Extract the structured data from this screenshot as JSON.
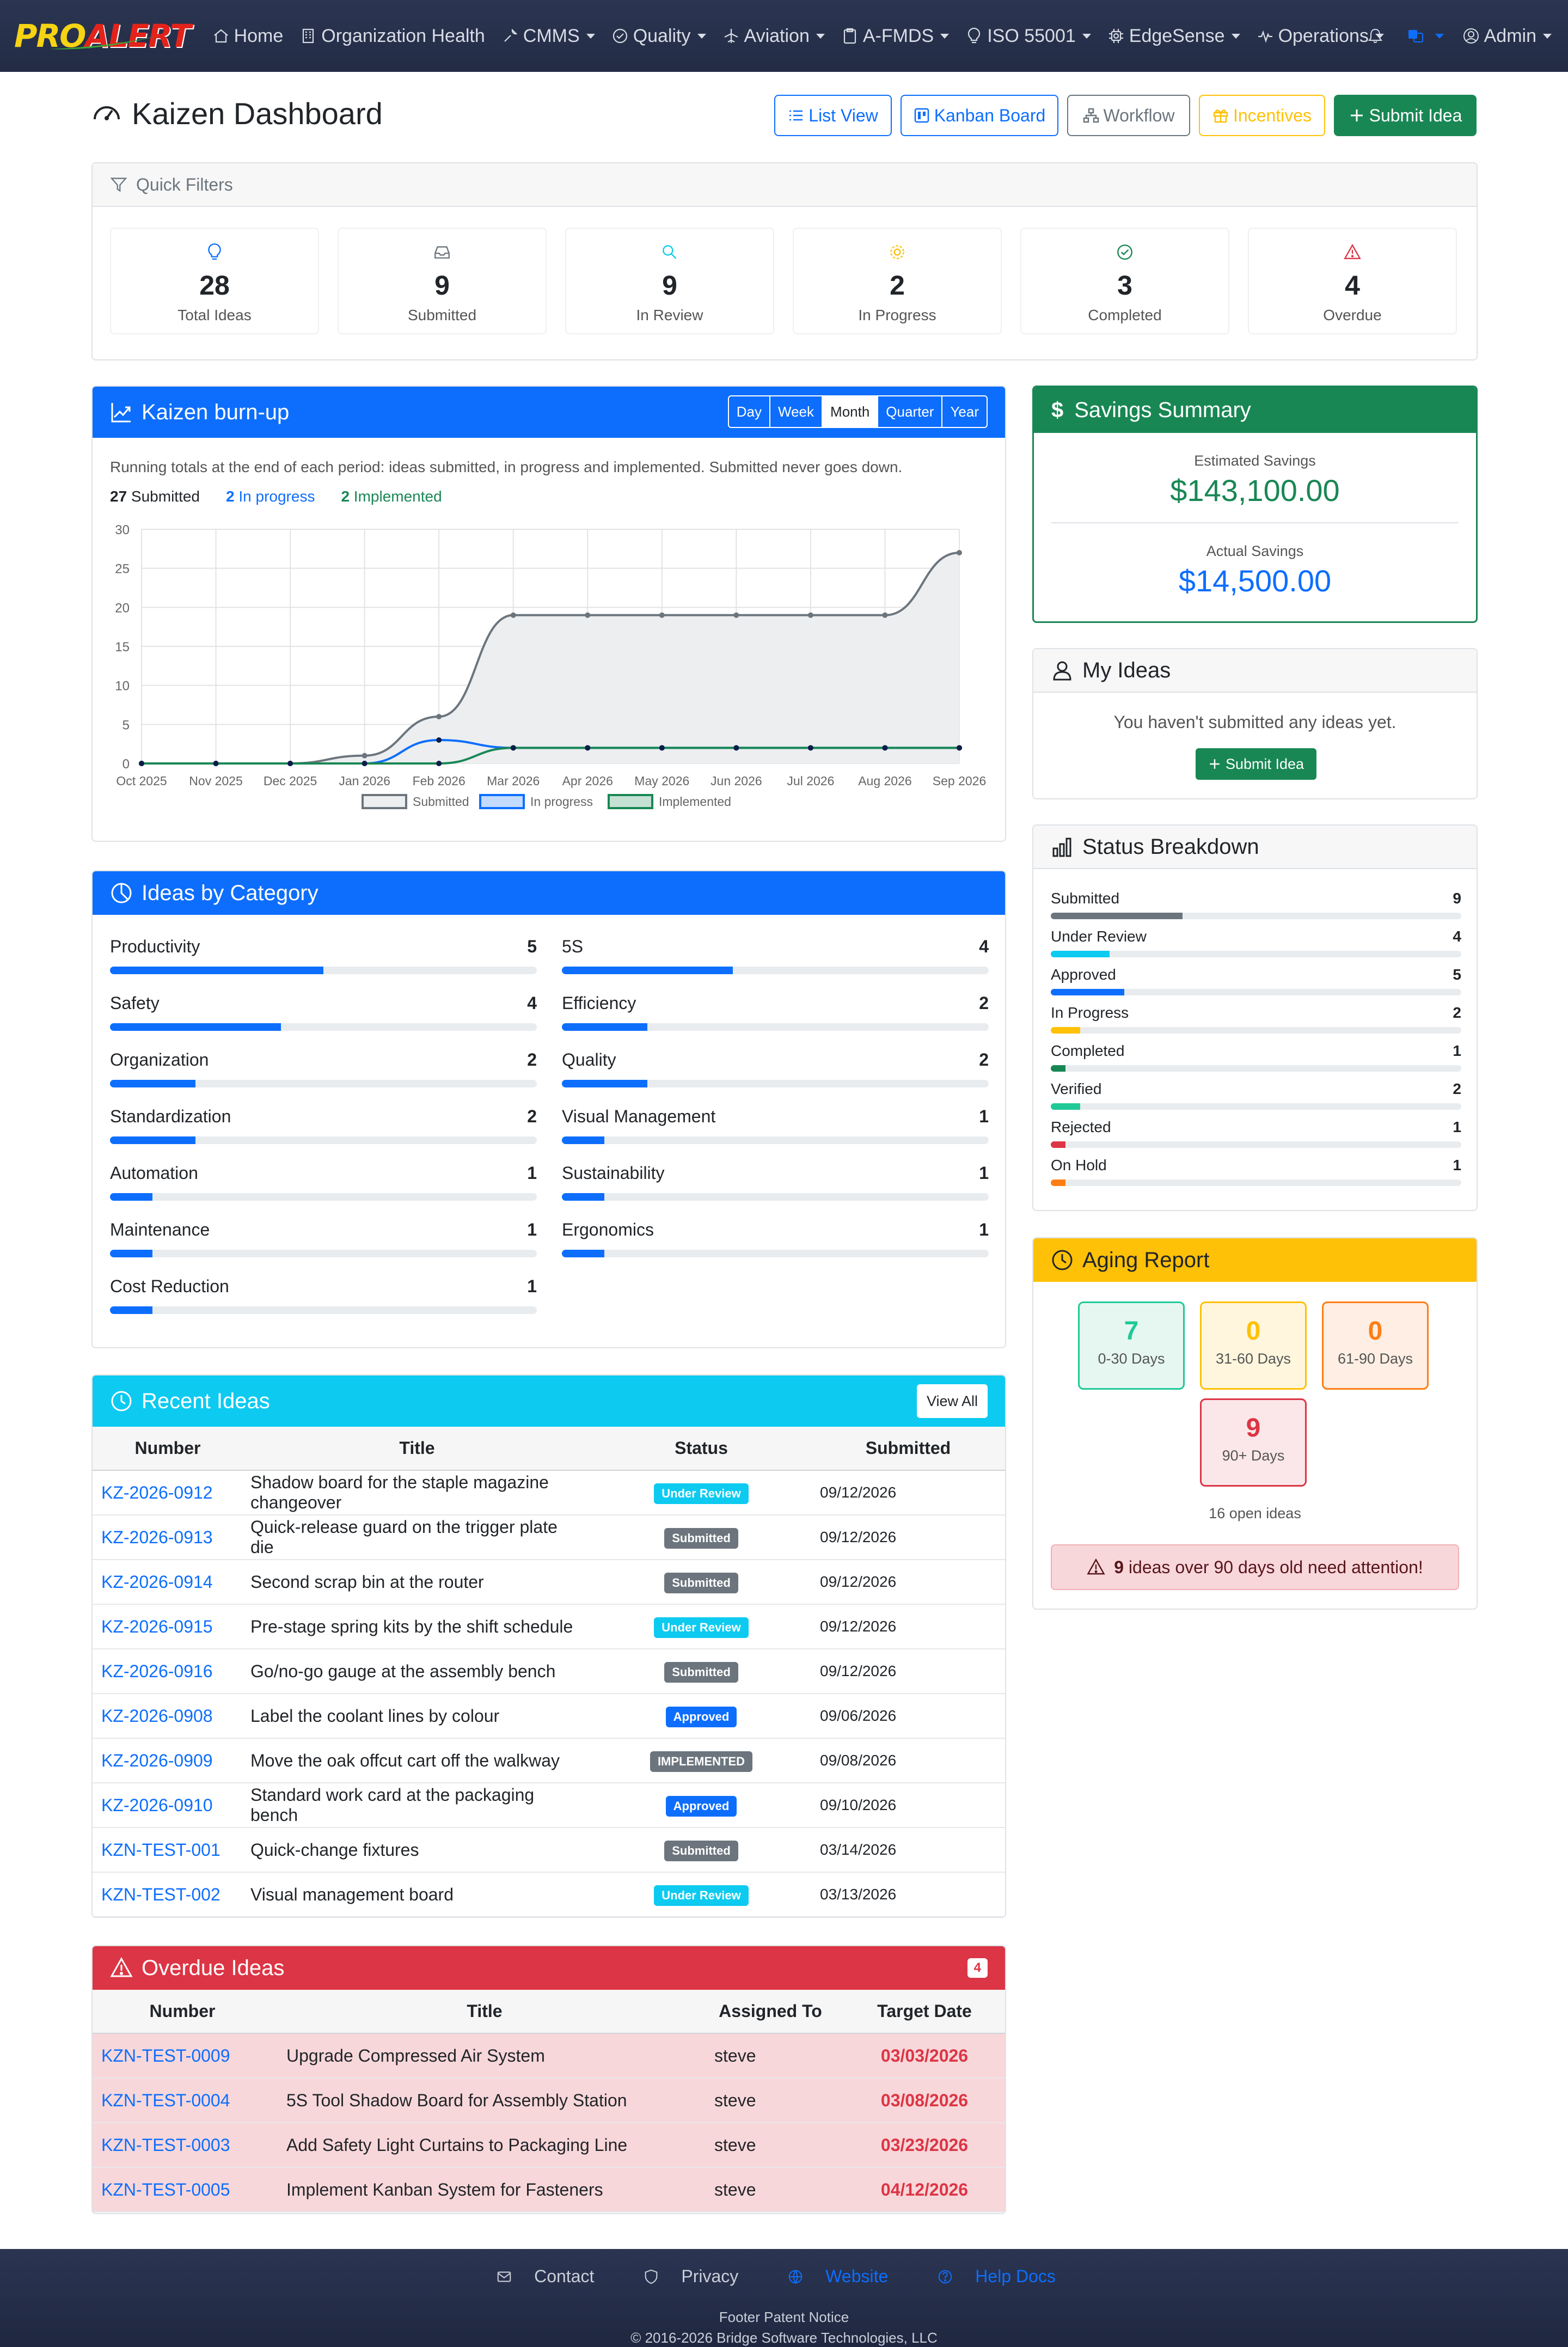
{
  "app": {
    "logo_pro": "PRO",
    "logo_alert": "ALERT",
    "nav": [
      {
        "label": "Home",
        "icon": "home-icon"
      },
      {
        "label": "Organization Health",
        "icon": "building-icon"
      },
      {
        "label": "CMMS",
        "icon": "wrench-icon"
      },
      {
        "label": "Quality",
        "icon": "check-circle-icon"
      },
      {
        "label": "Aviation",
        "icon": "airplane-icon"
      },
      {
        "label": "A-FMDS",
        "icon": "clipboard-icon"
      },
      {
        "label": "ISO 55001",
        "icon": "lightbulb-icon"
      },
      {
        "label": "EdgeSense",
        "icon": "cpu-icon"
      },
      {
        "label": "Operations",
        "icon": "activity-icon"
      }
    ],
    "user": "Admin"
  },
  "page": {
    "title": "Kaizen Dashboard",
    "buttons": {
      "list_view": "List View",
      "kanban": "Kanban Board",
      "workflow": "Workflow",
      "incentives": "Incentives",
      "submit": "Submit Idea"
    }
  },
  "quick_filters": {
    "title": "Quick Filters",
    "items": [
      {
        "value": "28",
        "label": "Total Ideas",
        "color": "#0d6efd",
        "icon": "lightbulb-icon"
      },
      {
        "value": "9",
        "label": "Submitted",
        "color": "#6c757d",
        "icon": "inbox-icon"
      },
      {
        "value": "9",
        "label": "In Review",
        "color": "#0dcaf0",
        "icon": "search-icon"
      },
      {
        "value": "2",
        "label": "In Progress",
        "color": "#ffc107",
        "icon": "gear-icon"
      },
      {
        "value": "3",
        "label": "Completed",
        "color": "#198754",
        "icon": "check-circle-icon"
      },
      {
        "value": "4",
        "label": "Overdue",
        "color": "#dc3545",
        "icon": "warning-icon"
      }
    ]
  },
  "burnup": {
    "title": "Kaizen burn-up",
    "periods": [
      "Day",
      "Week",
      "Month",
      "Quarter",
      "Year"
    ],
    "active_period": "Month",
    "description": "Running totals at the end of each period: ideas submitted, in progress and implemented. Submitted never goes down.",
    "totals": {
      "submitted_num": "27",
      "submitted_label": " Submitted",
      "progress_num": "2",
      "progress_label": " In progress",
      "implemented_num": "2",
      "implemented_label": " Implemented"
    }
  },
  "chart_data": {
    "type": "line",
    "x": [
      "Oct 2025",
      "Nov 2025",
      "Dec 2025",
      "Jan 2026",
      "Feb 2026",
      "Mar 2026",
      "Apr 2026",
      "May 2026",
      "Jun 2026",
      "Jul 2026",
      "Aug 2026",
      "Sep 2026"
    ],
    "ylim": [
      0,
      30
    ],
    "yticks": [
      0,
      5,
      10,
      15,
      20,
      25,
      30
    ],
    "series": [
      {
        "name": "Submitted",
        "values": [
          0,
          0,
          0,
          1,
          6,
          19,
          19,
          19,
          19,
          19,
          19,
          27
        ],
        "color": "#6c757d",
        "fill": "#eceef0"
      },
      {
        "name": "In progress",
        "values": [
          0,
          0,
          0,
          0,
          3,
          2,
          2,
          2,
          2,
          2,
          2,
          2
        ],
        "color": "#0d6efd"
      },
      {
        "name": "Implemented",
        "values": [
          0,
          0,
          0,
          0,
          0,
          2,
          2,
          2,
          2,
          2,
          2,
          2
        ],
        "color": "#198754"
      }
    ],
    "legend": "bottom",
    "grid": true
  },
  "categories": {
    "title": "Ideas by Category",
    "max": 10,
    "items": [
      {
        "name": "Productivity",
        "value": 5
      },
      {
        "name": "5S",
        "value": 4
      },
      {
        "name": "Safety",
        "value": 4
      },
      {
        "name": "Efficiency",
        "value": 2
      },
      {
        "name": "Organization",
        "value": 2
      },
      {
        "name": "Quality",
        "value": 2
      },
      {
        "name": "Standardization",
        "value": 2
      },
      {
        "name": "Visual Management",
        "value": 1
      },
      {
        "name": "Automation",
        "value": 1
      },
      {
        "name": "Sustainability",
        "value": 1
      },
      {
        "name": "Maintenance",
        "value": 1
      },
      {
        "name": "Ergonomics",
        "value": 1
      },
      {
        "name": "Cost Reduction",
        "value": 1
      }
    ]
  },
  "recent": {
    "title": "Recent Ideas",
    "view_all": "View All",
    "columns": [
      "Number",
      "Title",
      "Status",
      "Submitted"
    ],
    "rows": [
      {
        "number": "KZ-2026-0912",
        "title": "Shadow board for the staple magazine changeover",
        "status": "Under Review",
        "color": "#0dcaf0",
        "date": "09/12/2026"
      },
      {
        "number": "KZ-2026-0913",
        "title": "Quick-release guard on the trigger plate die",
        "status": "Submitted",
        "color": "#6c757d",
        "date": "09/12/2026"
      },
      {
        "number": "KZ-2026-0914",
        "title": "Second scrap bin at the router",
        "status": "Submitted",
        "color": "#6c757d",
        "date": "09/12/2026"
      },
      {
        "number": "KZ-2026-0915",
        "title": "Pre-stage spring kits by the shift schedule",
        "status": "Under Review",
        "color": "#0dcaf0",
        "date": "09/12/2026"
      },
      {
        "number": "KZ-2026-0916",
        "title": "Go/no-go gauge at the assembly bench",
        "status": "Submitted",
        "color": "#6c757d",
        "date": "09/12/2026"
      },
      {
        "number": "KZ-2026-0908",
        "title": "Label the coolant lines by colour",
        "status": "Approved",
        "color": "#0d6efd",
        "date": "09/06/2026"
      },
      {
        "number": "KZ-2026-0909",
        "title": "Move the oak offcut cart off the walkway",
        "status": "IMPLEMENTED",
        "color": "#6c757d",
        "date": "09/08/2026"
      },
      {
        "number": "KZ-2026-0910",
        "title": "Standard work card at the packaging bench",
        "status": "Approved",
        "color": "#0d6efd",
        "date": "09/10/2026"
      },
      {
        "number": "KZN-TEST-001",
        "title": "Quick-change fixtures",
        "status": "Submitted",
        "color": "#6c757d",
        "date": "03/14/2026"
      },
      {
        "number": "KZN-TEST-002",
        "title": "Visual management board",
        "status": "Under Review",
        "color": "#0dcaf0",
        "date": "03/13/2026"
      }
    ]
  },
  "overdue": {
    "title": "Overdue Ideas",
    "count": "4",
    "columns": [
      "Number",
      "Title",
      "Assigned To",
      "Target Date"
    ],
    "rows": [
      {
        "number": "KZN-TEST-0009",
        "title": "Upgrade Compressed Air System",
        "assigned": "steve",
        "date": "03/03/2026"
      },
      {
        "number": "KZN-TEST-0004",
        "title": "5S Tool Shadow Board for Assembly Station",
        "assigned": "steve",
        "date": "03/08/2026"
      },
      {
        "number": "KZN-TEST-0003",
        "title": "Add Safety Light Curtains to Packaging Line",
        "assigned": "steve",
        "date": "03/23/2026"
      },
      {
        "number": "KZN-TEST-0005",
        "title": "Implement Kanban System for Fasteners",
        "assigned": "steve",
        "date": "04/12/2026"
      }
    ]
  },
  "savings": {
    "title": "Savings Summary",
    "estimated_label": "Estimated Savings",
    "estimated_value": "$143,100.00",
    "actual_label": "Actual Savings",
    "actual_value": "$14,500.00"
  },
  "my_ideas": {
    "title": "My Ideas",
    "empty": "You haven't submitted any ideas yet.",
    "button": "Submit Idea"
  },
  "status_breakdown": {
    "title": "Status Breakdown",
    "max": 28,
    "items": [
      {
        "name": "Submitted",
        "value": 9,
        "color": "#6c757d"
      },
      {
        "name": "Under Review",
        "value": 4,
        "color": "#0dcaf0"
      },
      {
        "name": "Approved",
        "value": 5,
        "color": "#0d6efd"
      },
      {
        "name": "In Progress",
        "value": 2,
        "color": "#ffc107"
      },
      {
        "name": "Completed",
        "value": 1,
        "color": "#198754"
      },
      {
        "name": "Verified",
        "value": 2,
        "color": "#20c997"
      },
      {
        "name": "Rejected",
        "value": 1,
        "color": "#dc3545"
      },
      {
        "name": "On Hold",
        "value": 1,
        "color": "#fd7e14"
      }
    ]
  },
  "aging": {
    "title": "Aging Report",
    "boxes": [
      {
        "value": "7",
        "label": "0-30 Days",
        "color": "#20c997",
        "bg": "#e6f7f1"
      },
      {
        "value": "0",
        "label": "31-60 Days",
        "color": "#ffc107",
        "bg": "#fff6dd"
      },
      {
        "value": "0",
        "label": "61-90 Days",
        "color": "#fd7e14",
        "bg": "#feeee3"
      },
      {
        "value": "9",
        "label": "90+ Days",
        "color": "#dc3545",
        "bg": "#fbe7e9"
      }
    ],
    "open_text": "16 open ideas",
    "alert_num": "9",
    "alert_text": " ideas over 90 days old need attention!"
  },
  "footer": {
    "links": [
      {
        "label": "Contact",
        "icon": "envelope-icon",
        "color": "#c9ced9"
      },
      {
        "label": "Privacy",
        "icon": "shield-icon",
        "color": "#c9ced9"
      },
      {
        "label": "Website",
        "icon": "globe-icon",
        "color": "#0d6efd"
      },
      {
        "label": "Help Docs",
        "icon": "question-circle-icon",
        "color": "#0d6efd"
      }
    ],
    "notice": "Footer Patent Notice",
    "copyright": "© 2016-2026 Bridge Software Technologies, LLC"
  }
}
